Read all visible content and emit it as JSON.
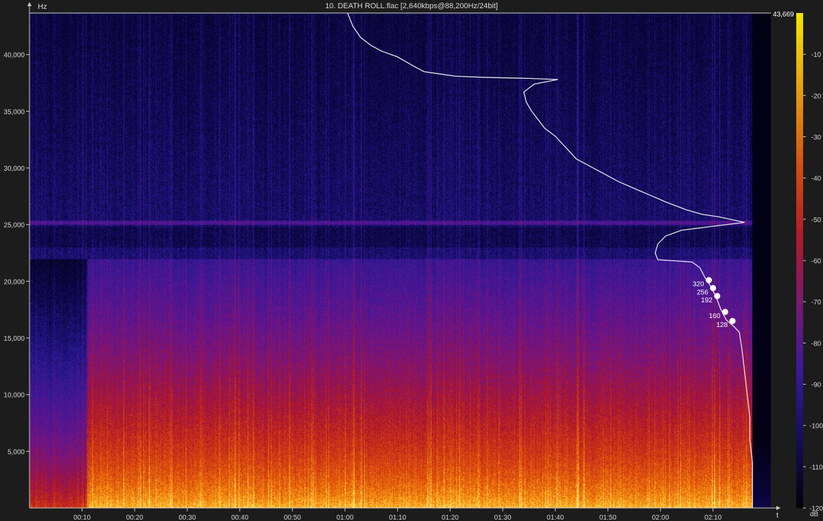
{
  "title": "10. DEATH ROLL.flac [2,640kbps@88,200Hz/24bit]",
  "x_unit": "t",
  "y_unit": "Hz",
  "colorbar_unit": "dB",
  "max_freq_label": "43,669",
  "colors": {
    "background": "#1c1c1c",
    "axis": "#cfcfcf",
    "curve": "#e8e8e8",
    "marker": "#ffffff"
  },
  "chart_data": {
    "type": "heatmap",
    "title": "10. DEATH ROLL.flac [2,640kbps@88,200Hz/24bit]",
    "xlabel": "t",
    "ylabel": "Hz",
    "x_ticks": [
      "00:10",
      "00:20",
      "00:30",
      "00:40",
      "00:50",
      "01:00",
      "01:10",
      "01:20",
      "01:30",
      "01:40",
      "01:50",
      "02:00",
      "02:10"
    ],
    "x_tick_values": [
      10,
      20,
      30,
      40,
      50,
      60,
      70,
      80,
      90,
      100,
      110,
      120,
      130
    ],
    "xlim": [
      0,
      141
    ],
    "y_ticks": [
      "5,000",
      "10,000",
      "15,000",
      "20,000",
      "25,000",
      "30,000",
      "35,000",
      "40,000"
    ],
    "y_tick_values": [
      5000,
      10000,
      15000,
      20000,
      25000,
      30000,
      35000,
      40000
    ],
    "ylim": [
      0,
      43669
    ],
    "colorbar": {
      "label": "dB",
      "ticks": [
        "-10",
        "-20",
        "-30",
        "-40",
        "-50",
        "-60",
        "-70",
        "-80",
        "-90",
        "-100",
        "-110",
        "-120"
      ],
      "tick_values": [
        -10,
        -20,
        -30,
        -40,
        -50,
        -60,
        -70,
        -80,
        -90,
        -100,
        -110,
        -120
      ],
      "range": [
        -120,
        0
      ]
    },
    "curve": {
      "x_axis": "t",
      "points": [
        {
          "t": 60.5,
          "hz": 43669
        },
        {
          "t": 61.5,
          "hz": 42500
        },
        {
          "t": 63,
          "hz": 41500
        },
        {
          "t": 65,
          "hz": 40800
        },
        {
          "t": 67,
          "hz": 40300
        },
        {
          "t": 70,
          "hz": 39800
        },
        {
          "t": 73,
          "hz": 39000
        },
        {
          "t": 75,
          "hz": 38500
        },
        {
          "t": 78,
          "hz": 38300
        },
        {
          "t": 81,
          "hz": 38100
        },
        {
          "t": 86,
          "hz": 38000
        },
        {
          "t": 95,
          "hz": 37900
        },
        {
          "t": 100.5,
          "hz": 37800
        },
        {
          "t": 96,
          "hz": 37400
        },
        {
          "t": 94,
          "hz": 36700
        },
        {
          "t": 94.5,
          "hz": 35800
        },
        {
          "t": 95.5,
          "hz": 35000
        },
        {
          "t": 98,
          "hz": 33500
        },
        {
          "t": 100,
          "hz": 32800
        },
        {
          "t": 102,
          "hz": 31800
        },
        {
          "t": 104,
          "hz": 30800
        },
        {
          "t": 108,
          "hz": 29800
        },
        {
          "t": 112,
          "hz": 28800
        },
        {
          "t": 116,
          "hz": 28000
        },
        {
          "t": 118,
          "hz": 27600
        },
        {
          "t": 121,
          "hz": 27000
        },
        {
          "t": 125,
          "hz": 26300
        },
        {
          "t": 128,
          "hz": 25900
        },
        {
          "t": 131,
          "hz": 25700
        },
        {
          "t": 136,
          "hz": 25200
        },
        {
          "t": 129,
          "hz": 24800
        },
        {
          "t": 124,
          "hz": 24500
        },
        {
          "t": 121,
          "hz": 24000
        },
        {
          "t": 119.5,
          "hz": 23300
        },
        {
          "t": 119,
          "hz": 22500
        },
        {
          "t": 119.5,
          "hz": 21900
        },
        {
          "t": 123,
          "hz": 21800
        },
        {
          "t": 126,
          "hz": 21700
        },
        {
          "t": 127.5,
          "hz": 21200
        },
        {
          "t": 128.5,
          "hz": 20300
        },
        {
          "t": 129.5,
          "hz": 19600
        },
        {
          "t": 130.5,
          "hz": 18700
        },
        {
          "t": 131.5,
          "hz": 17500
        },
        {
          "t": 132.5,
          "hz": 16600
        },
        {
          "t": 134,
          "hz": 16000
        },
        {
          "t": 135,
          "hz": 15500
        },
        {
          "t": 135.5,
          "hz": 14000
        },
        {
          "t": 136,
          "hz": 12000
        },
        {
          "t": 136.5,
          "hz": 10000
        },
        {
          "t": 137,
          "hz": 8000
        },
        {
          "t": 137,
          "hz": 6000
        },
        {
          "t": 137.5,
          "hz": 4000
        },
        {
          "t": 137.5,
          "hz": 2000
        },
        {
          "t": 137.5,
          "hz": 0
        }
      ]
    },
    "bitrate_markers": [
      {
        "label": "320",
        "t": 129.2,
        "hz": 20100
      },
      {
        "label": "256",
        "t": 130.0,
        "hz": 19400
      },
      {
        "label": "192",
        "t": 130.8,
        "hz": 18700
      },
      {
        "label": "160",
        "t": 132.3,
        "hz": 17300
      },
      {
        "label": "128",
        "t": 133.7,
        "hz": 16500
      }
    ]
  }
}
